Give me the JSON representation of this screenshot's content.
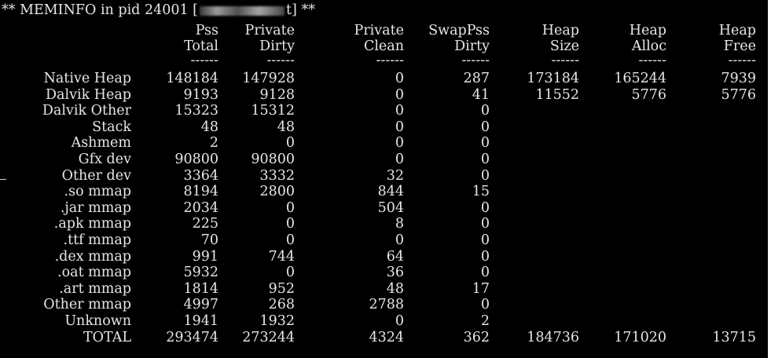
{
  "header": {
    "prefix": "** MEMINFO in pid 24001 [",
    "suffix": "t] **"
  },
  "columns": [
    {
      "top": "Pss",
      "bottom": "Total"
    },
    {
      "top": "Private",
      "bottom": "Dirty"
    },
    {
      "top": "Private",
      "bottom": "Clean"
    },
    {
      "top": "SwapPss",
      "bottom": "Dirty"
    },
    {
      "top": "Heap",
      "bottom": "Size"
    },
    {
      "top": "Heap",
      "bottom": "Alloc"
    },
    {
      "top": "Heap",
      "bottom": "Free"
    }
  ],
  "separator": "------",
  "rows": [
    {
      "label": "Native Heap",
      "values": [
        "148184",
        "147928",
        "0",
        "287",
        "173184",
        "165244",
        "7939"
      ]
    },
    {
      "label": "Dalvik Heap",
      "values": [
        "9193",
        "9128",
        "0",
        "41",
        "11552",
        "5776",
        "5776"
      ]
    },
    {
      "label": "Dalvik Other",
      "values": [
        "15323",
        "15312",
        "0",
        "0"
      ]
    },
    {
      "label": "Stack",
      "values": [
        "48",
        "48",
        "0",
        "0"
      ]
    },
    {
      "label": "Ashmem",
      "values": [
        "2",
        "0",
        "0",
        "0"
      ]
    },
    {
      "label": "Gfx dev",
      "values": [
        "90800",
        "90800",
        "0",
        "0"
      ]
    },
    {
      "label": "Other dev",
      "values": [
        "3364",
        "3332",
        "32",
        "0"
      ]
    },
    {
      "label": ".so mmap",
      "values": [
        "8194",
        "2800",
        "844",
        "15"
      ]
    },
    {
      "label": ".jar mmap",
      "values": [
        "2034",
        "0",
        "504",
        "0"
      ]
    },
    {
      "label": ".apk mmap",
      "values": [
        "225",
        "0",
        "8",
        "0"
      ]
    },
    {
      "label": ".ttf mmap",
      "values": [
        "70",
        "0",
        "0",
        "0"
      ]
    },
    {
      "label": ".dex mmap",
      "values": [
        "991",
        "744",
        "64",
        "0"
      ]
    },
    {
      "label": ".oat mmap",
      "values": [
        "5932",
        "0",
        "36",
        "0"
      ]
    },
    {
      "label": ".art mmap",
      "values": [
        "1814",
        "952",
        "48",
        "17"
      ]
    },
    {
      "label": "Other mmap",
      "values": [
        "4997",
        "268",
        "2788",
        "0"
      ]
    },
    {
      "label": "Unknown",
      "values": [
        "1941",
        "1932",
        "0",
        "2"
      ]
    },
    {
      "label": "TOTAL",
      "values": [
        "293474",
        "273244",
        "4324",
        "362",
        "184736",
        "171020",
        "13715"
      ]
    }
  ]
}
